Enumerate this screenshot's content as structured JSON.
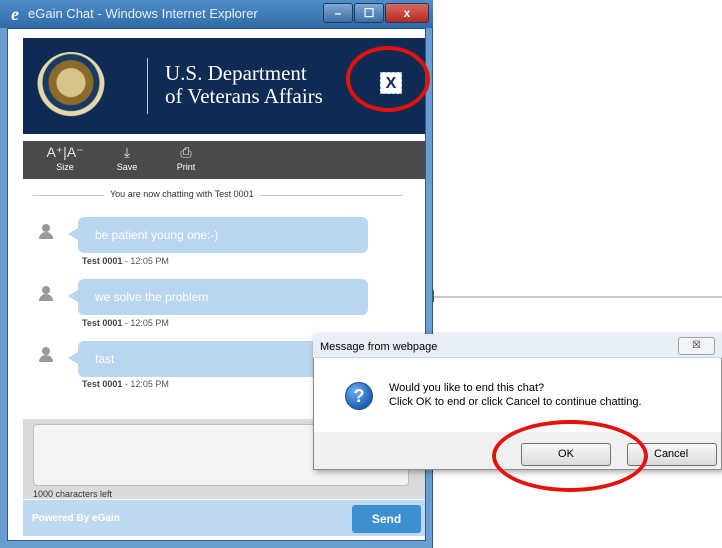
{
  "window": {
    "title": "eGain Chat - Windows Internet Explorer",
    "logo_glyph": "e",
    "min_glyph": "–",
    "max_glyph": "☐",
    "close_glyph": "x"
  },
  "header": {
    "agency_name_line1": "U.S. Department",
    "agency_name_line2": "of Veterans Affairs",
    "close_glyph": "X"
  },
  "toolbar": {
    "items": [
      {
        "icon": "text-size-icon",
        "glyph": "A⁺|A⁻",
        "label": "Size"
      },
      {
        "icon": "download-icon",
        "glyph": "⤓",
        "label": "Save"
      },
      {
        "icon": "printer-icon",
        "glyph": "⎙",
        "label": "Print"
      }
    ]
  },
  "chat": {
    "status": "You are now chatting with Test 0001",
    "messages": [
      {
        "text": "be patient young one:-)",
        "author": "Test 0001",
        "time": "- 12:05 PM"
      },
      {
        "text": "we solve the problem",
        "author": "Test 0001",
        "time": "- 12:05 PM"
      },
      {
        "text": "fast",
        "author": "Test 0001",
        "time": "- 12:05 PM"
      }
    ]
  },
  "composer": {
    "chars_left": "1000 characters left",
    "powered_prefix": "Powered By ",
    "powered_brand": "eGain",
    "send_label": "Send"
  },
  "dialog": {
    "title": "Message from webpage",
    "close_glyph": "☒",
    "icon_glyph": "?",
    "line1": "Would you like to end this chat?",
    "line2": "Click OK to end or click Cancel to continue chatting.",
    "ok_label": "OK",
    "cancel_label": "Cancel"
  },
  "colors": {
    "va_navy": "#0d2b53",
    "bubble_blue": "#b9d5ef",
    "send_blue": "#3d8fd1",
    "highlight_red": "#e3120b"
  }
}
